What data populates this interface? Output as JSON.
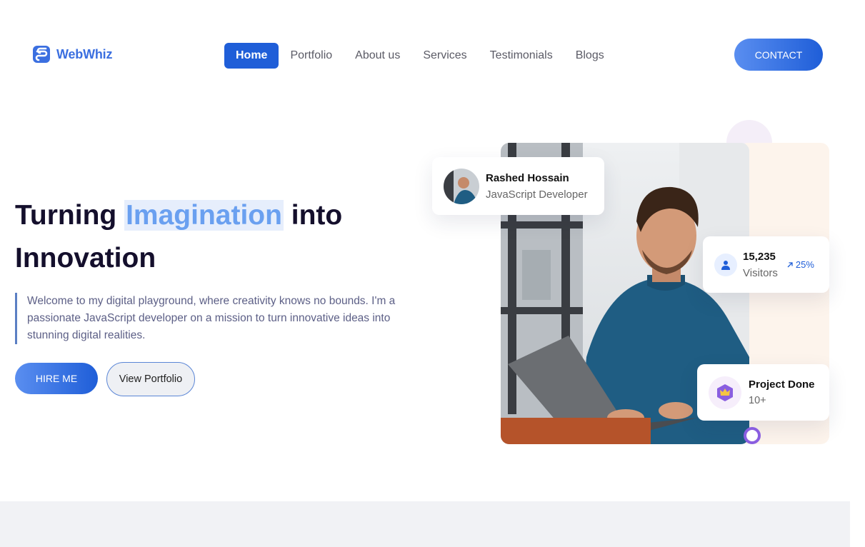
{
  "header": {
    "logo_text": "WebWhiz",
    "nav": [
      {
        "label": "Home",
        "active": true
      },
      {
        "label": "Portfolio",
        "active": false
      },
      {
        "label": "About us",
        "active": false
      },
      {
        "label": "Services",
        "active": false
      },
      {
        "label": "Testimonials",
        "active": false
      },
      {
        "label": "Blogs",
        "active": false
      }
    ],
    "contact_label": "CONTACT"
  },
  "hero": {
    "title_before": "Turning ",
    "title_highlight": "Imagination",
    "title_after": " into",
    "title_line2": "Innovation",
    "description": "Welcome to my digital playground, where creativity knows no bounds. I'm a passionate JavaScript developer on a mission to turn innovative ideas into stunning digital realities.",
    "hire_label": "HIRE ME",
    "portfolio_label": "View Portfolio"
  },
  "profile_card": {
    "name": "Rashed Hossain",
    "role": "JavaScript Developer",
    "avatar_icon": "avatar-photo"
  },
  "visitors_card": {
    "icon": "user-icon",
    "count": "15,235",
    "label": "Visitors",
    "growth": "25%",
    "growth_icon": "arrow-up-right-icon"
  },
  "project_card": {
    "icon": "crown-icon",
    "title": "Project Done",
    "count": "10+"
  },
  "colors": {
    "brand": "#1f5ed8",
    "brand_light": "#5a8ef0",
    "highlight_text": "#6aa0f0",
    "peach": "#fdf4ec",
    "ring": "#8a5ee0"
  }
}
